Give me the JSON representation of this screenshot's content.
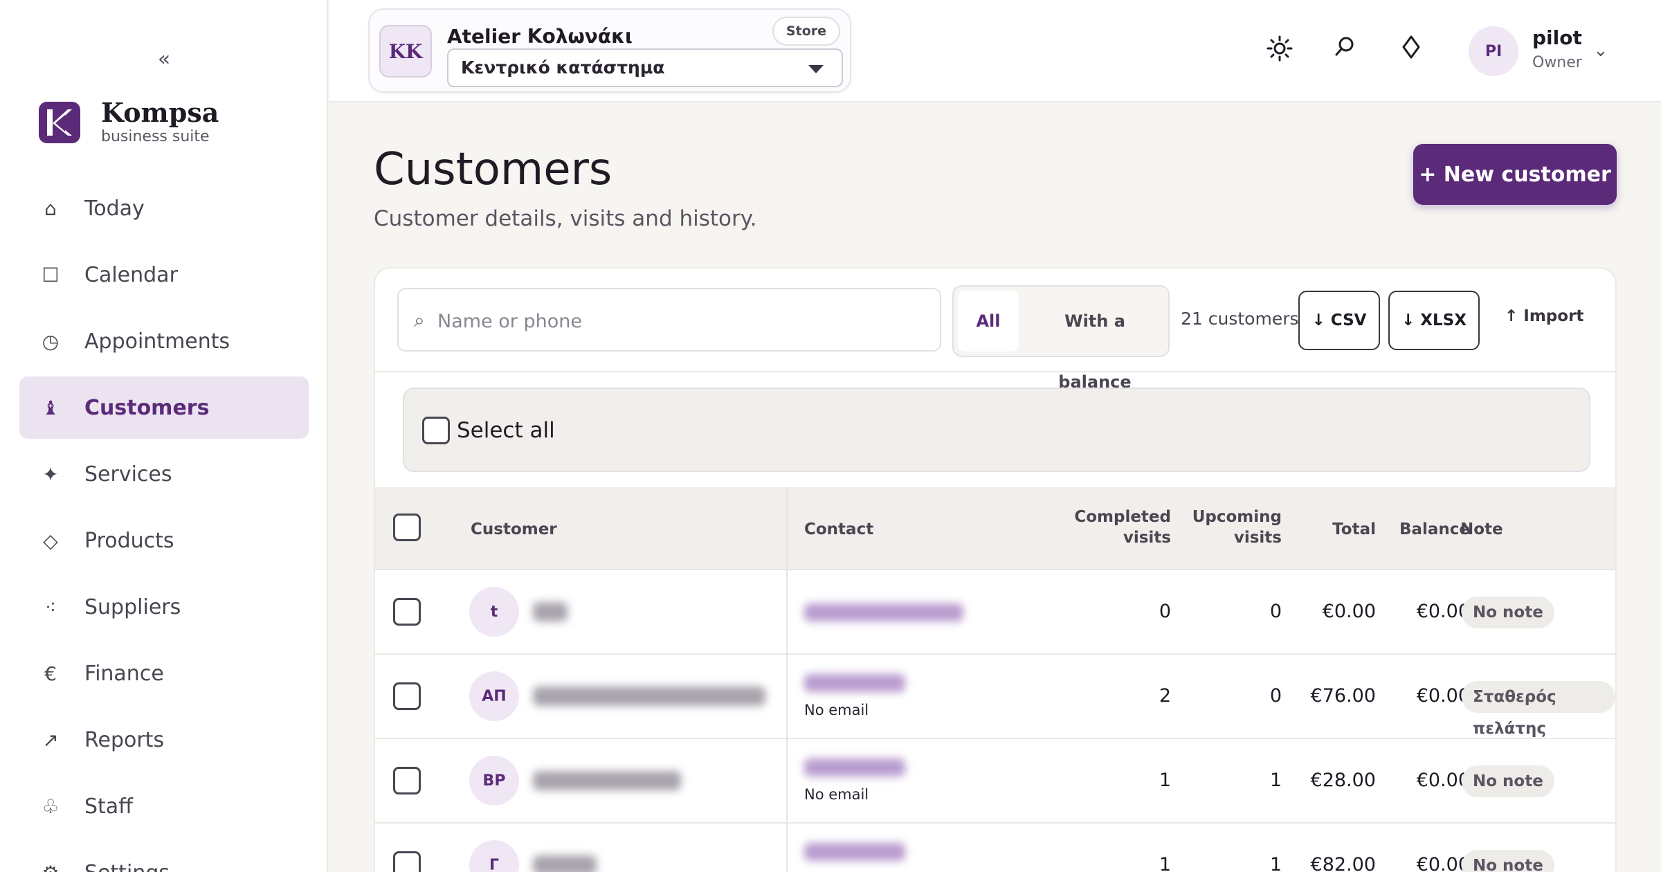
{
  "sidebar": {
    "collapse_label": "«",
    "brand": {
      "name": "Kompsa",
      "subtitle": "business suite"
    },
    "items": [
      {
        "label": "Today",
        "icon": "home-icon",
        "glyph": "⌂"
      },
      {
        "label": "Calendar",
        "icon": "calendar-icon",
        "glyph": "☐"
      },
      {
        "label": "Appointments",
        "icon": "clock-icon",
        "glyph": "◷"
      },
      {
        "label": "Customers",
        "icon": "user-icon",
        "glyph": "♝",
        "active": true
      },
      {
        "label": "Services",
        "icon": "sparkle-icon",
        "glyph": "✦"
      },
      {
        "label": "Products",
        "icon": "diamond-icon",
        "glyph": "◇"
      },
      {
        "label": "Suppliers",
        "icon": "dots-icon",
        "glyph": "⁖"
      },
      {
        "label": "Finance",
        "icon": "euro-icon",
        "glyph": "€"
      },
      {
        "label": "Reports",
        "icon": "arrow-up-right-icon",
        "glyph": "↗"
      },
      {
        "label": "Staff",
        "icon": "staff-icon",
        "glyph": "♧"
      },
      {
        "label": "Settings",
        "icon": "gear-icon",
        "glyph": "⚙"
      }
    ]
  },
  "topbar": {
    "store": {
      "initials": "KK",
      "name": "Atelier Κολωνάκι",
      "tag": "Store",
      "selected_location": "Κεντρικό κατάστημα"
    },
    "icons": [
      "sun-icon",
      "search-icon",
      "diamond-icon"
    ],
    "user": {
      "initials": "PI",
      "name": "pilot",
      "role": "Owner"
    }
  },
  "main": {
    "title": "Customers",
    "subtitle": "Customer details, visits and history.",
    "new_button": "+ New customer",
    "toolbar": {
      "search_placeholder": "Name or phone",
      "filters": [
        "All",
        "With a balance"
      ],
      "active_filter": "All",
      "count": "21 customers",
      "csv": "↓ CSV",
      "xlsx": "↓ XLSX",
      "import": "↑ Import"
    },
    "select_all": "Select all",
    "table": {
      "headers": {
        "customer": "Customer",
        "contact": "Contact",
        "completed": [
          "Completed",
          "visits"
        ],
        "upcoming": [
          "Upcoming",
          "visits"
        ],
        "total": "Total",
        "balance": "Balance",
        "note": "Note"
      },
      "rows": [
        {
          "initials": "t",
          "email": "",
          "completed": "0",
          "upcoming": "0",
          "total": "€0.00",
          "balance": "€0.00",
          "note": "No note"
        },
        {
          "initials": "ΑΠ",
          "email": "No email",
          "completed": "2",
          "upcoming": "0",
          "total": "€76.00",
          "balance": "€0.00",
          "note": "Σταθερός πελάτης"
        },
        {
          "initials": "ΒΡ",
          "email": "No email",
          "completed": "1",
          "upcoming": "1",
          "total": "€28.00",
          "balance": "€0.00",
          "note": "No note"
        },
        {
          "initials": "Γ",
          "email": "",
          "completed": "1",
          "upcoming": "1",
          "total": "€82.00",
          "balance": "€0.00",
          "note": "No note"
        }
      ]
    }
  },
  "colors": {
    "accent": "#5b2b7a",
    "accent_soft": "#ece3f1",
    "surface": "#f6f5f2"
  }
}
